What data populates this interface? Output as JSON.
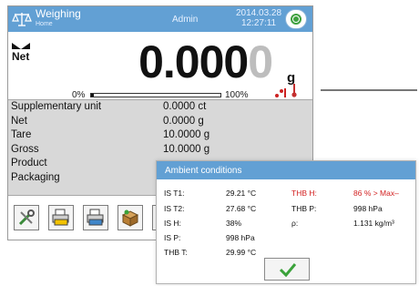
{
  "header": {
    "title": "Weighing",
    "subtitle": "Home",
    "user": "Admin",
    "date": "2014.03.28",
    "time": "12:27:11"
  },
  "weighing": {
    "net_label": "Net",
    "reading_main": "0.000",
    "reading_last_digit": "0",
    "unit": "g",
    "range_min_label": "0%",
    "range_max_label": "100%",
    "range_fill_fraction": 0.02
  },
  "info": {
    "rows": [
      {
        "label": "Supplementary unit",
        "value": "0.0000 ct"
      },
      {
        "label": "Net",
        "value": "0.0000 g"
      },
      {
        "label": "Tare",
        "value": "10.0000 g"
      },
      {
        "label": "Gross",
        "value": "10.0000 g"
      },
      {
        "label": "Product",
        "value": ""
      },
      {
        "label": "Packaging",
        "value": ""
      }
    ]
  },
  "toolbar": {
    "icons": [
      "settings-tools-icon",
      "printer-yellow-icon",
      "printer-blue-icon",
      "product-box-icon"
    ]
  },
  "ambient": {
    "title": "Ambient conditions",
    "left": [
      {
        "label": "IS T1:",
        "value": "29.21 °C"
      },
      {
        "label": "IS T2:",
        "value": "27.68 °C"
      },
      {
        "label": "IS H:",
        "value": "38%"
      },
      {
        "label": "IS P:",
        "value": "998 hPa"
      },
      {
        "label": "THB T:",
        "value": "29.99 °C"
      }
    ],
    "right": [
      {
        "label": "THB H:",
        "value": "86 % > Max–",
        "alert": true
      },
      {
        "label": "THB P:",
        "value": "998 hPa",
        "alert": false
      },
      {
        "label": "ρ:",
        "value": "1.131 kg/m³",
        "alert": false
      }
    ]
  },
  "colors": {
    "header_blue": "#62a0d4",
    "alert_red": "#d21f1f",
    "ok_green": "#3aa23a"
  }
}
